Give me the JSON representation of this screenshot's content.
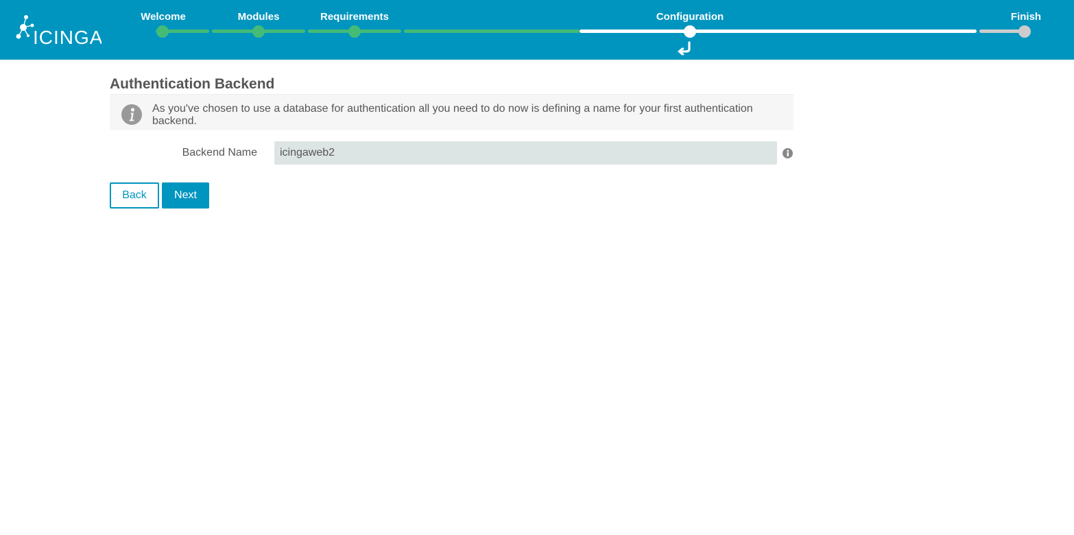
{
  "header": {
    "logo_text": "ICINGA",
    "steps": [
      {
        "label": "Welcome",
        "state": "done"
      },
      {
        "label": "Modules",
        "state": "done"
      },
      {
        "label": "Requirements",
        "state": "done"
      },
      {
        "label": "Configuration",
        "state": "current"
      },
      {
        "label": "Finish",
        "state": "pending"
      }
    ]
  },
  "main": {
    "title": "Authentication Backend",
    "info_text": "As you've chosen to use a database for authentication all you need to do now is defining a name for your first authentication backend.",
    "form": {
      "backend_name_label": "Backend Name",
      "backend_name_value": "icingaweb2"
    },
    "buttons": {
      "back_label": "Back",
      "next_label": "Next"
    }
  },
  "icons": [
    "icinga-logo-icon",
    "return-arrow-icon",
    "info-icon",
    "help-icon"
  ],
  "colors": {
    "header_bg": "#0095bf",
    "progress_done": "#44bb77",
    "progress_current": "#ffffff",
    "progress_pending": "#cccccc",
    "input_bg": "#dde4e4"
  }
}
